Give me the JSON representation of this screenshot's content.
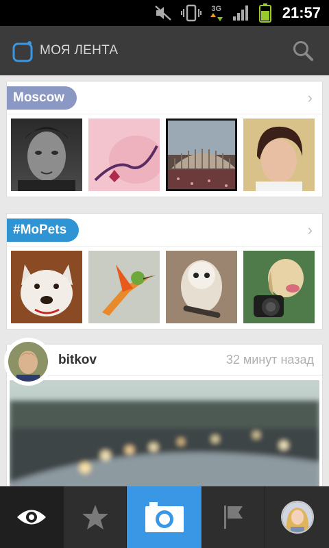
{
  "status_bar": {
    "time": "21:57",
    "network": "3G"
  },
  "action_bar": {
    "title": "МОЯ ЛЕНТА"
  },
  "groups": [
    {
      "tag": "Moscow",
      "color": "#8c98c4",
      "thumbs": [
        "portrait-man",
        "tattoo-text",
        "stadium",
        "young-man"
      ]
    },
    {
      "tag": "#MoPets",
      "color": "#2f94d4",
      "thumbs": [
        "pitbull",
        "bird",
        "owl",
        "dog-camera"
      ]
    }
  ],
  "post": {
    "user": "bitkov",
    "time": "32 минут назад"
  },
  "bottom_nav": {
    "items": [
      "feed-eye",
      "favorites-star",
      "camera",
      "flag",
      "profile"
    ],
    "active": "feed-eye",
    "camera_color": "#3a97e5"
  }
}
